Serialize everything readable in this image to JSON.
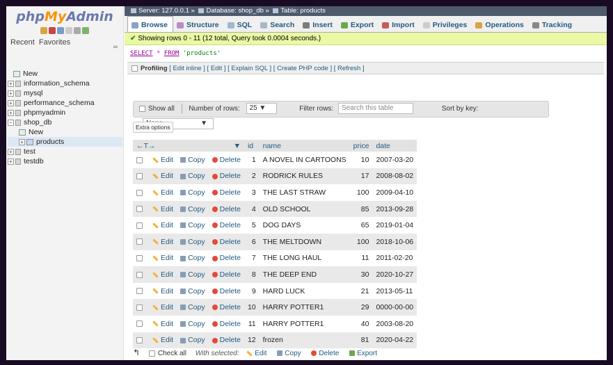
{
  "nav": {
    "logo_php": "php",
    "logo_my": "My",
    "logo_admin": "Admin",
    "tabs": [
      "Recent",
      "Favorites"
    ],
    "tree": [
      {
        "label": "New",
        "type": "new",
        "indent": 1
      },
      {
        "label": "information_schema",
        "type": "db",
        "indent": 0
      },
      {
        "label": "mysql",
        "type": "db",
        "indent": 0
      },
      {
        "label": "performance_schema",
        "type": "db",
        "indent": 0
      },
      {
        "label": "phpmyadmin",
        "type": "db",
        "indent": 0
      },
      {
        "label": "shop_db",
        "type": "db",
        "indent": 0
      },
      {
        "label": "New",
        "type": "new",
        "indent": 2
      },
      {
        "label": "products",
        "type": "table",
        "indent": 2
      },
      {
        "label": "test",
        "type": "db",
        "indent": 0
      },
      {
        "label": "testdb",
        "type": "db",
        "indent": 0
      }
    ]
  },
  "breadcrumb": {
    "server": "Server: 127.0.0.1",
    "database": "Database: shop_db",
    "table": "Table: products"
  },
  "tabs": [
    "Browse",
    "Structure",
    "SQL",
    "Search",
    "Insert",
    "Export",
    "Import",
    "Privileges",
    "Operations",
    "Tracking"
  ],
  "message": "Showing rows 0 - 11 (12 total, Query took 0.0004 seconds.)",
  "sql": {
    "select": "SELECT",
    "star": "*",
    "from": "FROM",
    "table": "'products'"
  },
  "profiling": {
    "label": "Profiling",
    "links": "[ Edit inline ] [ Edit ] [ Explain SQL ] [ Create PHP code ] [ Refresh ]"
  },
  "navbar": {
    "show_all": "Show all",
    "num_rows_label": "Number of rows:",
    "num_rows_value": "25",
    "filter_label": "Filter rows:",
    "filter_placeholder": "Search this table",
    "sort_label": "Sort by key:",
    "sort_value": "None"
  },
  "extra_options": "Extra options",
  "table": {
    "headers": {
      "arrows": "←T→",
      "id": "id",
      "name": "name",
      "price": "price",
      "date": "date"
    },
    "action_labels": {
      "edit": "Edit",
      "copy": "Copy",
      "delete": "Delete"
    },
    "rows": [
      {
        "id": "1",
        "name": "A NOVEL IN CARTOONS",
        "price": "10",
        "date": "2007-03-20"
      },
      {
        "id": "2",
        "name": "RODRICK RULES",
        "price": "17",
        "date": "2008-08-02"
      },
      {
        "id": "3",
        "name": "THE LAST STRAW",
        "price": "100",
        "date": "2009-04-10"
      },
      {
        "id": "4",
        "name": "OLD SCHOOL",
        "price": "85",
        "date": "2013-09-28"
      },
      {
        "id": "5",
        "name": "DOG DAYS",
        "price": "65",
        "date": "2019-01-04"
      },
      {
        "id": "6",
        "name": "THE MELTDOWN",
        "price": "100",
        "date": "2018-10-06"
      },
      {
        "id": "7",
        "name": "THE LONG HAUL",
        "price": "11",
        "date": "2011-02-20"
      },
      {
        "id": "8",
        "name": "THE DEEP END",
        "price": "30",
        "date": "2020-10-27"
      },
      {
        "id": "9",
        "name": "HARD LUCK",
        "price": "21",
        "date": "2013-05-11"
      },
      {
        "id": "10",
        "name": "HARRY POTTER1",
        "price": "29",
        "date": "0000-00-00"
      },
      {
        "id": "11",
        "name": "HARRY POTTER1",
        "price": "40",
        "date": "2003-08-20"
      },
      {
        "id": "12",
        "name": "frozen",
        "price": "81",
        "date": "2020-04-22"
      }
    ]
  },
  "bottom": {
    "check_all": "Check all",
    "with_selected": "With selected:",
    "edit": "Edit",
    "copy": "Copy",
    "delete": "Delete",
    "export": "Export"
  }
}
